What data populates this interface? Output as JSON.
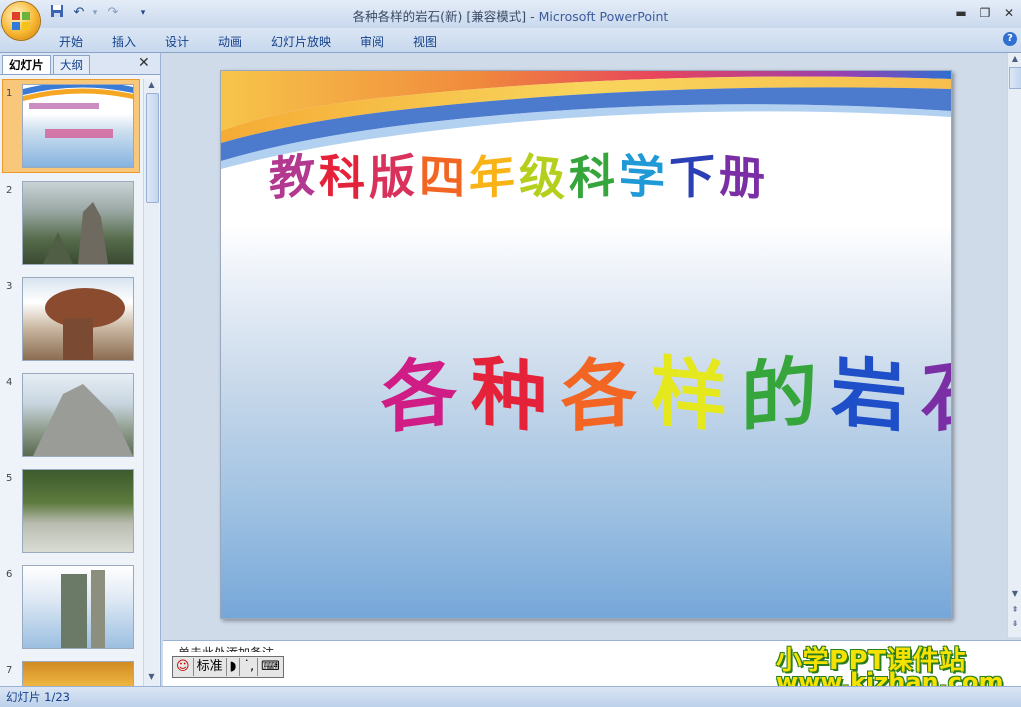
{
  "window": {
    "title": "各种各样的岩石(新) [兼容模式]",
    "title_sep": " - ",
    "app_name": "Microsoft PowerPoint"
  },
  "qat": {
    "save_icon": "save-icon",
    "undo_icon": "undo-icon",
    "redo_icon": "redo-icon",
    "customize_icon": "chevron-down-icon"
  },
  "ribbon_tabs": [
    "开始",
    "插入",
    "设计",
    "动画",
    "幻灯片放映",
    "审阅",
    "视图"
  ],
  "panel_tabs": {
    "slides": "幻灯片",
    "outline": "大纲"
  },
  "thumbnails": [
    "1",
    "2",
    "3",
    "4",
    "5",
    "6",
    "7"
  ],
  "slide": {
    "subtitle_chars": [
      "教",
      "科",
      "版",
      "四",
      "年",
      "级",
      "科",
      "学",
      "下",
      "册"
    ],
    "title_chars": [
      "各",
      "种",
      "各",
      "样",
      "的",
      "岩",
      "石"
    ]
  },
  "notes": {
    "placeholder": "单击此处添加备注"
  },
  "ime": {
    "mode": "标准"
  },
  "watermark": {
    "line1": "小学PPT课件站",
    "line2": "www.kjzhan.com"
  },
  "status": {
    "slide_info": "幻灯片 1/23"
  },
  "colors": {
    "rainbow": [
      "#c2187e",
      "#e4233a",
      "#f26522",
      "#f9b316",
      "#e4e81c",
      "#36a53c",
      "#1f9ad6",
      "#2b3fb6",
      "#7b2fa5"
    ]
  }
}
